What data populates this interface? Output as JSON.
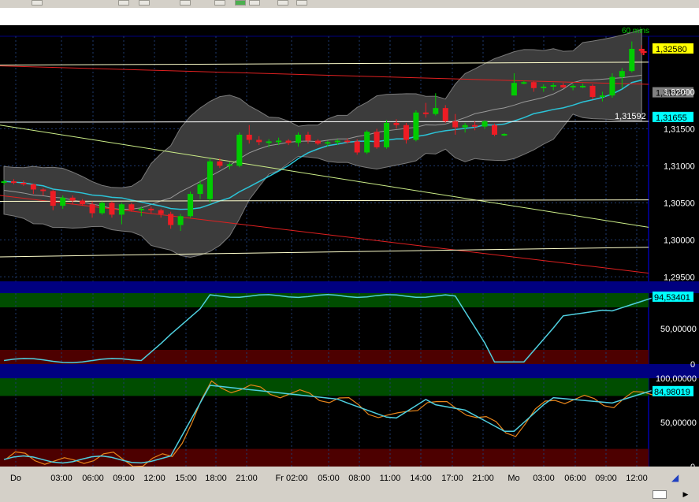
{
  "toolbar": {
    "buttons": [
      "left-edge",
      "btn-a",
      "btn-b",
      "btn-c",
      "btn-d",
      "btn-e",
      "btn-f",
      "btn-g",
      "btn-h"
    ]
  },
  "chart": {
    "timeframe_label": "60 mins",
    "x_axis_labels": [
      "Do",
      "03:00",
      "06:00",
      "09:00",
      "12:00",
      "15:00",
      "18:00",
      "21:00",
      "Fr 02:00",
      "05:00",
      "08:00",
      "11:00",
      "14:00",
      "17:00",
      "21:00",
      "Mo",
      "03:00",
      "06:00",
      "09:00",
      "12:00"
    ],
    "price_panel": {
      "y_ticks": [
        "1,32000",
        "1,31500",
        "1,31000",
        "1,30500",
        "1,30000",
        "1,29500"
      ],
      "tags": [
        {
          "text": "1,32580",
          "bg": "#ffff00",
          "fg": "#000000"
        },
        {
          "text": "1,31988",
          "bg": "#808080",
          "fg": "#000000"
        },
        {
          "text": "1,31655",
          "bg": "#00ffff",
          "fg": "#000000"
        }
      ],
      "annotation": "1,31592"
    },
    "osc1_panel": {
      "y_ticks": [
        "50,00000",
        "0"
      ],
      "tag": {
        "text": "94,53401",
        "bg": "#00ffff",
        "fg": "#000000"
      }
    },
    "osc2_panel": {
      "y_ticks": [
        "100,00000",
        "50,00000",
        "0"
      ],
      "tag": {
        "text": "84,98019",
        "bg": "#00ffff",
        "fg": "#000000"
      }
    }
  },
  "chart_data": {
    "type": "candlestick",
    "title": "",
    "timeframe": "60 mins",
    "x": [
      "Do",
      "03:00",
      "06:00",
      "09:00",
      "12:00",
      "15:00",
      "18:00",
      "21:00",
      "Fr 02:00",
      "05:00",
      "08:00",
      "11:00",
      "14:00",
      "17:00",
      "21:00",
      "Mo",
      "03:00",
      "06:00",
      "09:00",
      "12:00"
    ],
    "ylim": [
      1.2945,
      1.3275
    ],
    "last_price": 1.3258,
    "bollinger_middle_last": 1.31988,
    "moving_average_last": 1.31655,
    "annotation_value": 1.31592,
    "candles": [
      [
        1.3077,
        1.3081,
        1.3074,
        1.3079
      ],
      [
        1.3079,
        1.3082,
        1.3075,
        1.3077
      ],
      [
        1.3077,
        1.308,
        1.3073,
        1.3075
      ],
      [
        1.3075,
        1.3076,
        1.3062,
        1.3068
      ],
      [
        1.3068,
        1.307,
        1.306,
        1.3066
      ],
      [
        1.3066,
        1.3068,
        1.304,
        1.3046
      ],
      [
        1.3046,
        1.306,
        1.3042,
        1.3057
      ],
      [
        1.3057,
        1.306,
        1.3048,
        1.3053
      ],
      [
        1.3053,
        1.3055,
        1.3046,
        1.3048
      ],
      [
        1.3048,
        1.3052,
        1.303,
        1.3036
      ],
      [
        1.3036,
        1.3052,
        1.3034,
        1.305
      ],
      [
        1.305,
        1.3052,
        1.303,
        1.3034
      ],
      [
        1.3034,
        1.305,
        1.3021,
        1.3048
      ],
      [
        1.3048,
        1.305,
        1.3038,
        1.304
      ],
      [
        1.304,
        1.3045,
        1.3032,
        1.3042
      ],
      [
        1.3042,
        1.3045,
        1.3035,
        1.304
      ],
      [
        1.304,
        1.3042,
        1.303,
        1.3035
      ],
      [
        1.3035,
        1.3038,
        1.3015,
        1.302
      ],
      [
        1.302,
        1.3035,
        1.3012,
        1.3032
      ],
      [
        1.3032,
        1.3065,
        1.303,
        1.3062
      ],
      [
        1.3062,
        1.308,
        1.3055,
        1.3075
      ],
      [
        1.3055,
        1.311,
        1.305,
        1.3106
      ],
      [
        1.3106,
        1.311,
        1.3097,
        1.31
      ],
      [
        1.31,
        1.3105,
        1.3095,
        1.3102
      ],
      [
        1.31,
        1.3145,
        1.3098,
        1.3142
      ],
      [
        1.3142,
        1.3155,
        1.313,
        1.3135
      ],
      [
        1.3135,
        1.314,
        1.3128,
        1.3132
      ],
      [
        1.3132,
        1.3136,
        1.3125,
        1.3133
      ],
      [
        1.3133,
        1.3138,
        1.3128,
        1.3134
      ],
      [
        1.3134,
        1.3136,
        1.3128,
        1.3131
      ],
      [
        1.3131,
        1.3145,
        1.3126,
        1.3142
      ],
      [
        1.3142,
        1.3146,
        1.313,
        1.3134
      ],
      [
        1.3134,
        1.3136,
        1.3128,
        1.313
      ],
      [
        1.313,
        1.3134,
        1.3126,
        1.3132
      ],
      [
        1.3132,
        1.3136,
        1.3128,
        1.3134
      ],
      [
        1.3134,
        1.3137,
        1.313,
        1.3133
      ],
      [
        1.3133,
        1.3136,
        1.3115,
        1.3118
      ],
      [
        1.3118,
        1.3148,
        1.3116,
        1.3146
      ],
      [
        1.3146,
        1.315,
        1.3123,
        1.3125
      ],
      [
        1.3125,
        1.3162,
        1.3123,
        1.3158
      ],
      [
        1.3158,
        1.3163,
        1.315,
        1.3155
      ],
      [
        1.3155,
        1.3158,
        1.313,
        1.3135
      ],
      [
        1.3135,
        1.3175,
        1.3133,
        1.3172
      ],
      [
        1.3172,
        1.3185,
        1.3165,
        1.317
      ],
      [
        1.317,
        1.3198,
        1.3168,
        1.3178
      ],
      [
        1.3178,
        1.3182,
        1.3158,
        1.316
      ],
      [
        1.316,
        1.317,
        1.3142,
        1.3152
      ],
      [
        1.3152,
        1.3158,
        1.3145,
        1.3155
      ],
      [
        1.3155,
        1.316,
        1.3148,
        1.3153
      ],
      [
        1.3153,
        1.3162,
        1.315,
        1.316
      ],
      [
        1.3155,
        1.3157,
        1.314,
        1.3142
      ],
      [
        1.3142,
        1.3144,
        1.314,
        1.3143
      ],
      [
        1.3195,
        1.3225,
        1.3195,
        1.3212
      ],
      [
        1.3212,
        1.3215,
        1.321,
        1.3213
      ],
      [
        1.3213,
        1.3214,
        1.32,
        1.3205
      ],
      [
        1.3205,
        1.321,
        1.32,
        1.3207
      ],
      [
        1.3207,
        1.3212,
        1.3202,
        1.3209
      ],
      [
        1.3209,
        1.3212,
        1.3205,
        1.3206
      ],
      [
        1.3206,
        1.321,
        1.3202,
        1.3208
      ],
      [
        1.3208,
        1.3211,
        1.3205,
        1.3208
      ],
      [
        1.3208,
        1.321,
        1.319,
        1.3193
      ],
      [
        1.3193,
        1.32,
        1.3187,
        1.3195
      ],
      [
        1.3195,
        1.3225,
        1.3192,
        1.322
      ],
      [
        1.322,
        1.3232,
        1.3205,
        1.3228
      ],
      [
        1.3228,
        1.3268,
        1.3226,
        1.3258
      ],
      [
        1.3258,
        1.3263,
        1.325,
        1.3255
      ]
    ],
    "osc1_ylim": [
      0,
      100
    ],
    "osc1_last": 94.53401,
    "osc2_ylim": [
      0,
      100
    ],
    "osc2_last": 84.98019
  }
}
